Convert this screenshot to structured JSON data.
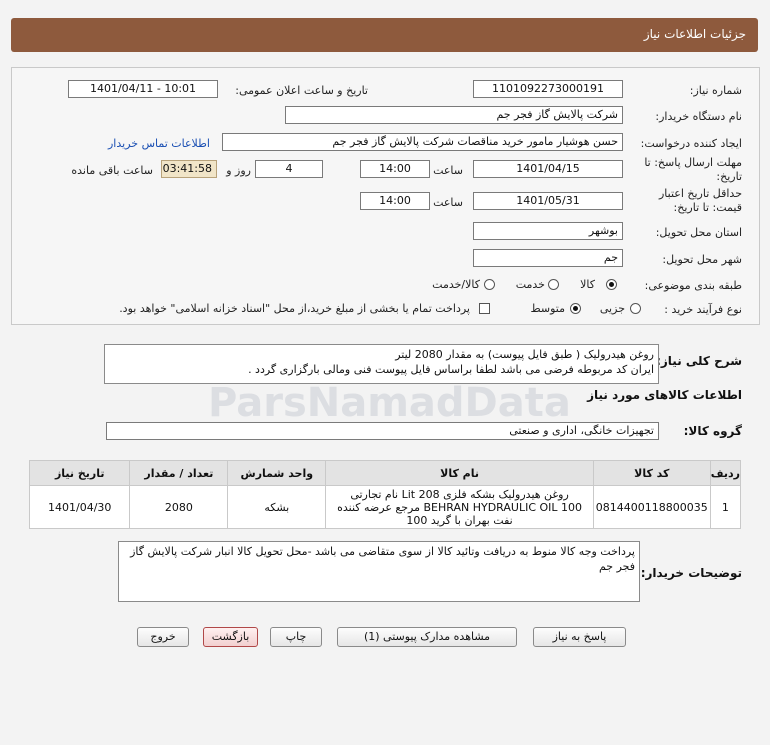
{
  "header": {
    "title": "جزئیات اطلاعات نیاز"
  },
  "labels": {
    "need_number": "شماره نیاز:",
    "announce_datetime": "تاریخ و ساعت اعلان عمومی:",
    "buyer_org": "نام دستگاه خریدار:",
    "requester": "ایجاد کننده درخواست:",
    "reply_deadline": "مهلت ارسال پاسخ: تا تاریخ:",
    "time": "ساعت",
    "days_and": "روز و",
    "remaining": "ساعت باقی مانده",
    "price_validity": "حداقل تاریخ اعتبار قیمت: تا تاریخ:",
    "province": "استان محل تحویل:",
    "city": "شهر محل تحویل:",
    "category": "طبقه بندی موضوعی:",
    "process": "نوع فرآیند خرید :",
    "summary": "شرح کلی نیاز:",
    "goods_info": "اطلاعات کالاهای مورد نیاز",
    "goods_group": "گروه کالا:",
    "buyer_notes": "توضیحات خریدار:"
  },
  "fields": {
    "need_number": "1101092273000191",
    "announce_datetime": "1401/04/11 - 10:01",
    "buyer_org": "شرکت پالایش گاز فجر جم",
    "requester": "حسن هوشیار مامور خرید مناقصات شرکت پالایش گاز فجر جم",
    "contact_link": "اطلاعات تماس خریدار",
    "reply_date": "1401/04/15",
    "reply_time": "14:00",
    "days": "4",
    "remaining_time": "03:41:58",
    "validity_date": "1401/05/31",
    "validity_time": "14:00",
    "province": "بوشهر",
    "city": "جم",
    "goods_group": "تجهیزات خانگی، اداری و صنعتی"
  },
  "category_options": [
    "کالا",
    "خدمت",
    "کالا/خدمت"
  ],
  "process_options": [
    "جزیی",
    "متوسط"
  ],
  "payment_note": "پرداخت تمام یا بخشی از مبلغ خرید،از محل \"اسناد خزانه اسلامی\" خواهد بود.",
  "summary_lines": [
    "روغن هیدرولیک ( طبق فایل پیوست) به مقدار 2080 لیتر",
    "ایران کد مربوطه فرضی می باشد لطفا براساس فایل پیوست فنی ومالی بارگزاری گردد  ."
  ],
  "table": {
    "headers": [
      "ردیف",
      "کد کالا",
      "نام کالا",
      "واحد شمارش",
      "تعداد / مقدار",
      "تاریخ نیاز"
    ],
    "rows": [
      {
        "row": "1",
        "code": "0814400118800035",
        "name": "روغن هیدرولیک بشکه فلزی Lit 208 نام تجارتی BEHRAN HYDRAULIC OIL 100 مرجع عرضه کننده نفت بهران با گرید 100",
        "unit": "بشکه",
        "qty": "2080",
        "date": "1401/04/30"
      }
    ]
  },
  "buyer_notes": "پرداخت وجه کالا منوط به دریافت وتائید کالا از سوی متقاضی می باشد -محل تحویل کالا انبار شرکت پالایش گاز فجر جم",
  "buttons": {
    "reply": "پاسخ به نیاز",
    "attachments": "مشاهده مدارک پیوستی (1)",
    "print": "چاپ",
    "back": "بازگشت",
    "exit": "خروج"
  },
  "watermark": {
    "brand": "ParsNamadData"
  }
}
